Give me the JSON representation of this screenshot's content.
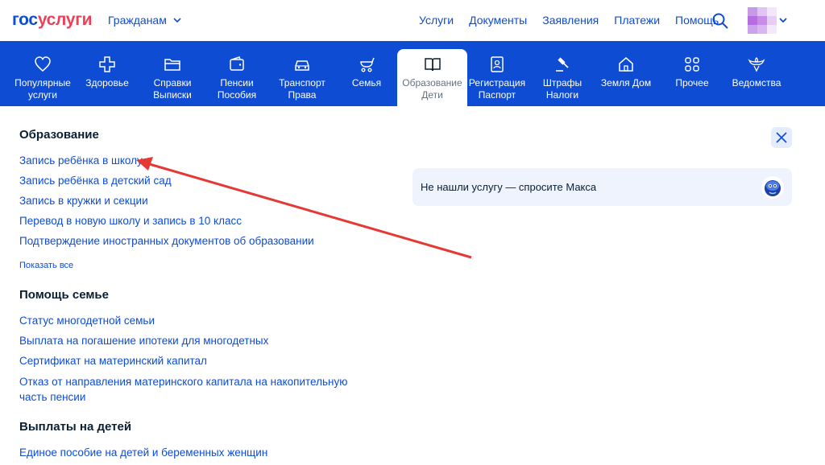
{
  "header": {
    "logo_part1": "гос",
    "logo_part2": "услуги",
    "role_label": "Гражданам",
    "nav": [
      "Услуги",
      "Документы",
      "Заявления",
      "Платежи",
      "Помощь"
    ]
  },
  "categories": [
    {
      "label": "Популярные\nуслуги",
      "icon": "heart-icon"
    },
    {
      "label": "Здоровье",
      "icon": "plus-cross-icon"
    },
    {
      "label": "Справки\nВыписки",
      "icon": "folder-icon"
    },
    {
      "label": "Пенсии\nПособия",
      "icon": "wallet-icon"
    },
    {
      "label": "Транспорт\nПрава",
      "icon": "car-icon"
    },
    {
      "label": "Семья",
      "icon": "stroller-icon"
    },
    {
      "label": "Образование\nДети",
      "icon": "book-icon",
      "active": true
    },
    {
      "label": "Регистрация\nПаспорт",
      "icon": "passport-icon"
    },
    {
      "label": "Штрафы\nНалоги",
      "icon": "gavel-icon"
    },
    {
      "label": "Земля Дом",
      "icon": "house-icon"
    },
    {
      "label": "Прочее",
      "icon": "grid-icon"
    },
    {
      "label": "Ведомства",
      "icon": "emblem-icon"
    }
  ],
  "sections": {
    "education": {
      "title": "Образование",
      "links": [
        "Запись ребёнка в школу",
        "Запись ребёнка в детский сад",
        "Запись в кружки и секции",
        "Перевод в новую школу и запись в 10 класс",
        "Подтверждение иностранных документов об образовании"
      ],
      "show_all": "Показать все"
    },
    "family_help": {
      "title": "Помощь семье",
      "links": [
        "Статус многодетной семьи",
        "Выплата на погашение ипотеки для многодетных",
        "Сертификат на материнский капитал",
        "Отказ от направления материнского капитала на накопительную часть пенсии"
      ]
    },
    "child_payments": {
      "title": "Выплаты на детей",
      "links": [
        "Единое пособие на детей и беременных женщин"
      ]
    }
  },
  "ask": {
    "text": "Не нашли услугу — спросите Макса"
  },
  "colors": {
    "brand_blue": "#0d4cd3",
    "brand_red": "#ee3f58",
    "annotation_arrow": "#e53935"
  }
}
